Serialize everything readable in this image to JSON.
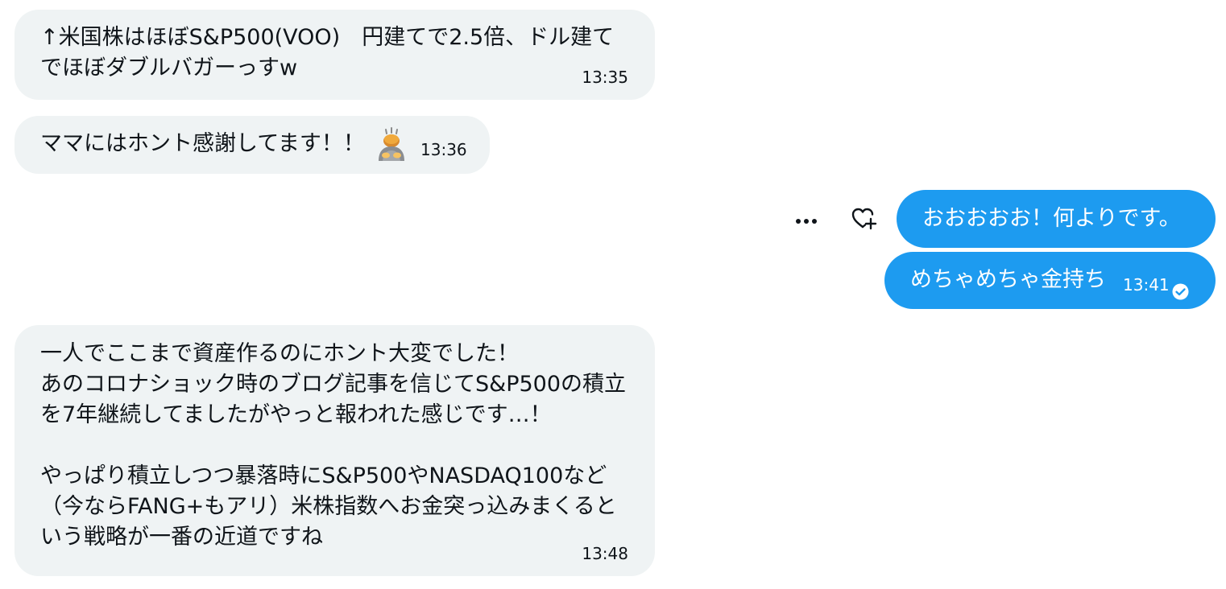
{
  "messages": [
    {
      "id": "m1",
      "direction": "incoming",
      "text": "↑米国株はほぼS&P500(VOO)　円建てで2.5倍、ドル建てでほぼダブルバガーっすw",
      "time": "13:35"
    },
    {
      "id": "m2",
      "direction": "incoming",
      "text": "ママにはホント感謝してます！！",
      "emoji": "person-bowing-emoji",
      "time": "13:36"
    },
    {
      "id": "m3",
      "direction": "outgoing",
      "text": "おおおおお！何よりです。"
    },
    {
      "id": "m4",
      "direction": "outgoing",
      "text": "めちゃめちゃ金持ち",
      "time": "13:41",
      "status": "sent-check-icon"
    },
    {
      "id": "m5",
      "direction": "incoming",
      "text": "一人でここまで資産作るのにホント大変でした！\nあのコロナショック時のブログ記事を信じてS&P500の積立を7年継続してましたがやっと報われた感じです…！\n\nやっぱり積立しつつ暴落時にS&P500やNASDAQ100など（今ならFANG+もアリ）米株指数へお金突っ込みまくるという戦略が一番の近道ですね",
      "time": "13:48"
    }
  ],
  "actions": {
    "more_icon": "more-horizontal-icon",
    "react_icon": "add-reaction-heart-icon"
  },
  "colors": {
    "incoming_bubble": "#eff3f4",
    "outgoing_bubble": "#1d9bf0",
    "text": "#0f1419",
    "outgoing_text": "#ffffff"
  }
}
